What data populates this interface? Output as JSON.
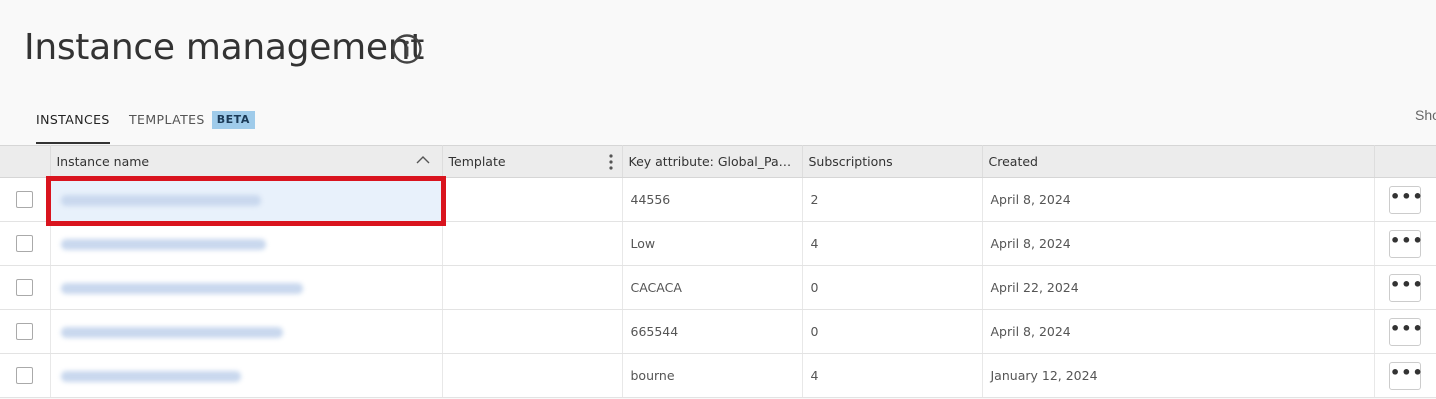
{
  "page": {
    "title": "Instance management",
    "info_icon": "info-circle-icon",
    "show_text": "Sho"
  },
  "tabs": [
    {
      "label": "INSTANCES",
      "active": true
    },
    {
      "label": "TEMPLATES",
      "active": false,
      "badge": "BETA"
    }
  ],
  "table": {
    "columns": [
      "",
      "Instance name",
      "Template",
      "Key attribute: Global_Part...",
      "Subscriptions",
      "Created",
      ""
    ],
    "sort_icon": "chevron-up-icon",
    "column_menu_icon": "kebab-vertical-icon",
    "row_action_label": "•••",
    "rows": [
      {
        "name": "",
        "template": "",
        "key_attribute": "44556",
        "subscriptions": "2",
        "created": "April 8, 2024",
        "highlighted": true
      },
      {
        "name": "",
        "template": "",
        "key_attribute": "Low",
        "subscriptions": "4",
        "created": "April 8, 2024",
        "highlighted": false
      },
      {
        "name": "",
        "template": "",
        "key_attribute": "CACACA",
        "subscriptions": "0",
        "created": "April 22, 2024",
        "highlighted": false
      },
      {
        "name": "",
        "template": "",
        "key_attribute": "665544",
        "subscriptions": "0",
        "created": "April 8, 2024",
        "highlighted": false
      },
      {
        "name": "",
        "template": "",
        "key_attribute": "bourne",
        "subscriptions": "4",
        "created": "January 12, 2024",
        "highlighted": false
      }
    ]
  },
  "colors": {
    "highlight_border": "#d9141e",
    "beta_badge_bg": "#9fcbea",
    "header_bg": "#ececec"
  }
}
